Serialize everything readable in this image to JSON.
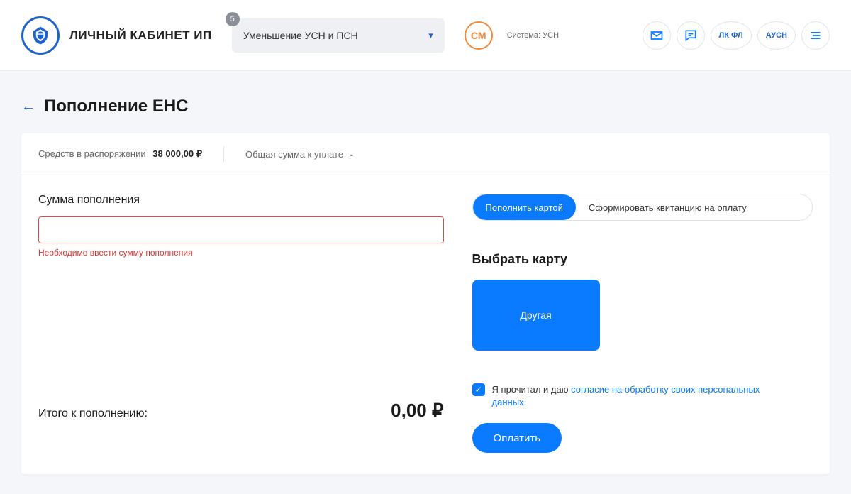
{
  "header": {
    "site_title": "ЛИЧНЫЙ КАБИНЕТ ИП",
    "dropdown_label": "Уменьшение УСН и ПСН",
    "dropdown_badge": "5",
    "avatar_initials": "СМ",
    "system_label": "Система: УСН",
    "btn_lkfl": "ЛК ФЛ",
    "btn_ausn": "АУСН"
  },
  "page": {
    "title": "Пополнение ЕНС",
    "available_label": "Средств в распоряжении",
    "available_value": "38 000,00 ₽",
    "due_label": "Общая сумма к уплате",
    "due_value": "-"
  },
  "form": {
    "amount_label": "Сумма пополнения",
    "amount_value": "",
    "amount_error": "Необходимо ввести сумму пополнения",
    "total_label": "Итого к пополнению:",
    "total_value": "0,00 ₽"
  },
  "right": {
    "tab_card": "Пополнить картой",
    "tab_receipt": "Сформировать квитанцию на оплату",
    "select_card_label": "Выбрать карту",
    "card_option_other": "Другая",
    "consent_prefix": "Я прочитал и даю ",
    "consent_link": "согласие на обработку своих персональных данных.",
    "pay_button": "Оплатить"
  }
}
